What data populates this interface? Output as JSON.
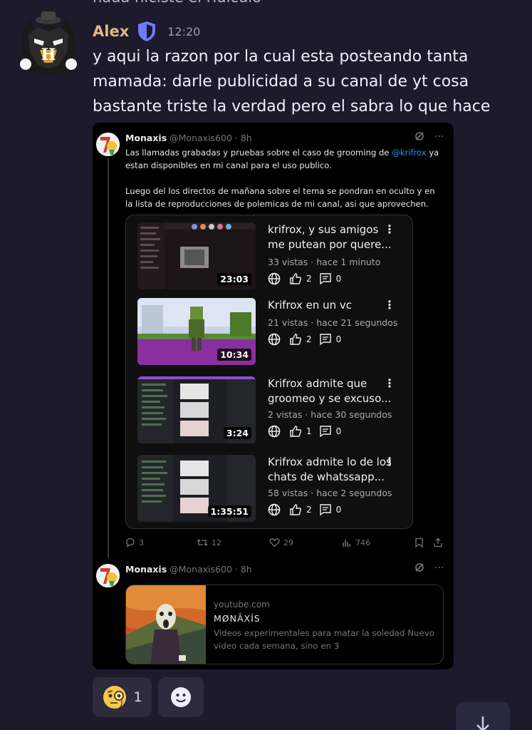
{
  "previous_message": {
    "text": "nada hiciste el ridiculo"
  },
  "message": {
    "author": "Alex",
    "time": "12:20",
    "text": "y aqui la razon por la cual esta posteando tanta mamada: darle publicidad a su canal de yt cosa bastante triste la verdad pero el sabra lo que hace",
    "author_color": "#e0b884"
  },
  "tweet1": {
    "name": "Monaxis",
    "handle": "@Monaxis600 · 8h",
    "text_before": "Las llamadas grabadas y pruebas sobre el caso de grooming de ",
    "mention": "@krifrox",
    "text_after": " ya estan disponibles en mi canal para el uso publico.",
    "text2": "Luego del los directos de mañana sobre el tema se pondran en oculto y en la lista de reproducciones de polemicas de mi canal, asi que aprovechen.",
    "videos": [
      {
        "title": "krifrox, y sus amigos me putean por quere...",
        "meta": "33 vistas · hace 1 minuto",
        "duration": "23:03",
        "likes": "2",
        "comments": "0"
      },
      {
        "title": "Krifrox en un vc",
        "meta": "21 vistas · hace 21 segundos",
        "duration": "10:34",
        "likes": "2",
        "comments": "0"
      },
      {
        "title": "Krifrox admite que groomeo y se excuso...",
        "meta": "2 vistas · hace 30 segundos",
        "duration": "3:24",
        "likes": "1",
        "comments": "0"
      },
      {
        "title": "Krifrox admite lo de los chats de whatssapp...",
        "meta": "58 vistas · hace 2 segundos",
        "duration": "1:35:51",
        "likes": "2",
        "comments": "0"
      }
    ],
    "stats": {
      "replies": "3",
      "retweets": "12",
      "likes": "29",
      "views": "746"
    }
  },
  "tweet2": {
    "name": "Monaxis",
    "handle": "@Monaxis600 · 8h",
    "link": {
      "domain": "youtube.com",
      "title": "MØNĀXÍS",
      "description": "Videos experimentales para matar la soledad Nuevo video cada semana, sino en 3"
    }
  },
  "reactions": [
    {
      "emoji": "monocle-face",
      "count": "1"
    },
    {
      "emoji": "add-reaction",
      "count": ""
    }
  ],
  "colors": {
    "background": "#1c1a2b",
    "embed_bg": "#000000",
    "mention": "#1d9bf0"
  }
}
